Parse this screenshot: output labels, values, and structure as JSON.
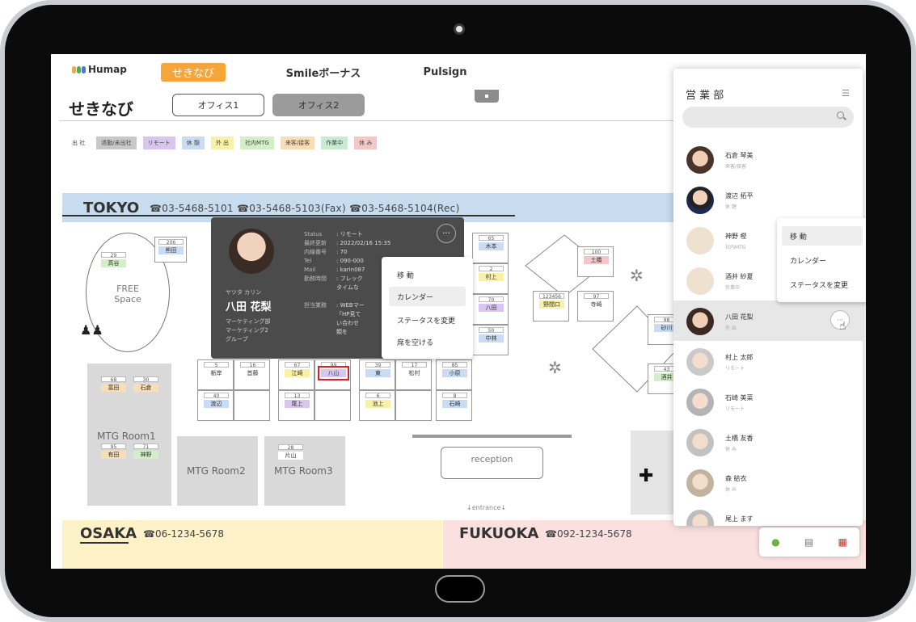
{
  "app": {
    "logo": "Humap",
    "tabs": [
      "せきなび",
      "Smileボーナス",
      "Pulsign"
    ],
    "page_title": "せきなび",
    "office_tabs": [
      "オフィス1",
      "オフィス2"
    ]
  },
  "legend": [
    {
      "label": "出 社",
      "color": "#ffffff"
    },
    {
      "label": "退勤/未出社",
      "color": "#c8c8c8"
    },
    {
      "label": "リモート",
      "color": "#d9c6ef"
    },
    {
      "label": "休 憩",
      "color": "#c9dcf3"
    },
    {
      "label": "外 出",
      "color": "#f8f1a8"
    },
    {
      "label": "社内MTG",
      "color": "#d2efc8"
    },
    {
      "label": "来客/接客",
      "color": "#f8ddb5"
    },
    {
      "label": "作業中",
      "color": "#c9ecd1"
    },
    {
      "label": "休 み",
      "color": "#f4c6c6"
    }
  ],
  "tokyo": {
    "name": "TOKYO",
    "phones": "☎03-5468-5101 ☎03-5468-5103(Fax) ☎03-5468-5104(Rec)"
  },
  "osaka": {
    "name": "OSAKA",
    "phone": "☎06-1234-5678"
  },
  "fukuoka": {
    "name": "FUKUOKA",
    "phone": "☎092-1234-5678"
  },
  "free_space": "FREE\nSpace",
  "rooms": {
    "mtg1": "MTG Room1",
    "mtg2": "MTG Room2",
    "mtg3": "MTG Room3",
    "reception": "reception",
    "entrance": "↓entrance↓"
  },
  "desks": [
    {
      "n": "29",
      "name": "高谷",
      "color": "#d2efc8"
    },
    {
      "n": "206",
      "name": "熊田",
      "color": "#c9dcf3"
    },
    {
      "n": "5",
      "name": "栃岸",
      "color": "#ffffff"
    },
    {
      "n": "16",
      "name": "首藤",
      "color": "#ffffff"
    },
    {
      "n": "67",
      "name": "江崎",
      "color": "#f8f1a8"
    },
    {
      "n": "99",
      "name": "八山",
      "color": "#d9c6ef"
    },
    {
      "n": "39",
      "name": "東",
      "color": "#c9dcf3"
    },
    {
      "n": "17",
      "name": "松村",
      "color": "#ffffff"
    },
    {
      "n": "85",
      "name": "小原",
      "color": "#c9dcf3"
    },
    {
      "n": "40",
      "name": "渡辺",
      "color": "#c9dcf3"
    },
    {
      "n": "13",
      "name": "尾上",
      "color": "#d9c6ef"
    },
    {
      "n": "6",
      "name": "池上",
      "color": "#f8f1a8"
    },
    {
      "n": "8",
      "name": "石崎",
      "color": "#c9dcf3"
    },
    {
      "n": "65",
      "name": "木本",
      "color": "#c9dcf3"
    },
    {
      "n": "2",
      "name": "村上",
      "color": "#f8f1a8"
    },
    {
      "n": "70",
      "name": "八田",
      "color": "#d9c6ef"
    },
    {
      "n": "50",
      "name": "中林",
      "color": "#c9dcf3"
    },
    {
      "n": "100",
      "name": "土橋",
      "color": "#f4c6c6"
    },
    {
      "n": "123456",
      "name": "野間口",
      "color": "#f8f1a8"
    },
    {
      "n": "97",
      "name": "寺崎",
      "color": "#ffffff"
    },
    {
      "n": "98",
      "name": "砂川",
      "color": "#c9dcf3"
    },
    {
      "n": "43",
      "name": "酒井",
      "color": "#d2efc8"
    },
    {
      "n": "68",
      "name": "富田",
      "color": "#f8ddb5"
    },
    {
      "n": "30",
      "name": "石倉",
      "color": "#f8ddb5"
    },
    {
      "n": "95",
      "name": "有田",
      "color": "#f8ddb5"
    },
    {
      "n": "71",
      "name": "神野",
      "color": "#d2efc8"
    },
    {
      "n": "28",
      "name": "片山",
      "color": "#ffffff"
    }
  ],
  "profile_popup": {
    "kana": "ヤツタ カリン",
    "name": "八田 花梨",
    "dept": [
      "マーケティング部",
      "マーケティング2",
      "グループ"
    ],
    "info": [
      {
        "k": "Status",
        "v": ": リモート"
      },
      {
        "k": "最終更新",
        "v": ": 2022/02/16 15:35"
      },
      {
        "k": "内線番号",
        "v": ": 70"
      },
      {
        "k": "Tel",
        "v": ": 090-000"
      },
      {
        "k": "Mail",
        "v": ": karin087"
      },
      {
        "k": "勤務時間",
        "v": ": フレック"
      },
      {
        "k": "",
        "v": "タイムな"
      },
      {
        "k": "",
        "v": ""
      },
      {
        "k": "担当業務",
        "v": ": WEBマー"
      },
      {
        "k": "",
        "v": "「HP見て"
      },
      {
        "k": "",
        "v": "い合わせ"
      },
      {
        "k": "",
        "v": "類を"
      }
    ],
    "more": "···"
  },
  "popup_menu": [
    "移 動",
    "カレンダー",
    "ステータスを変更",
    "席を空ける"
  ],
  "panel": {
    "title": "営 業 部",
    "search_placeholder": "",
    "people": [
      {
        "name": "石倉 琴美",
        "status": "来客/接客"
      },
      {
        "name": "渡辺 拓平",
        "status": "休 憩"
      },
      {
        "name": "神野 樫",
        "status": "社内MTG"
      },
      {
        "name": "酒井 紗夏",
        "status": "作業中"
      },
      {
        "name": "八田 花梨",
        "status": "外 出"
      },
      {
        "name": "村上 太郎",
        "status": "リモート"
      },
      {
        "name": "石崎 美菜",
        "status": "リモート"
      },
      {
        "name": "土橋 友香",
        "status": "休 み"
      },
      {
        "name": "森 結衣",
        "status": "休 み"
      },
      {
        "name": "尾上 ます",
        "status": ""
      }
    ]
  },
  "side_menu": [
    "移 動",
    "カレンダー",
    "ステータスを変更"
  ],
  "toolbar_icons": [
    "map-pin-icon",
    "document-icon",
    "calendar-icon"
  ]
}
